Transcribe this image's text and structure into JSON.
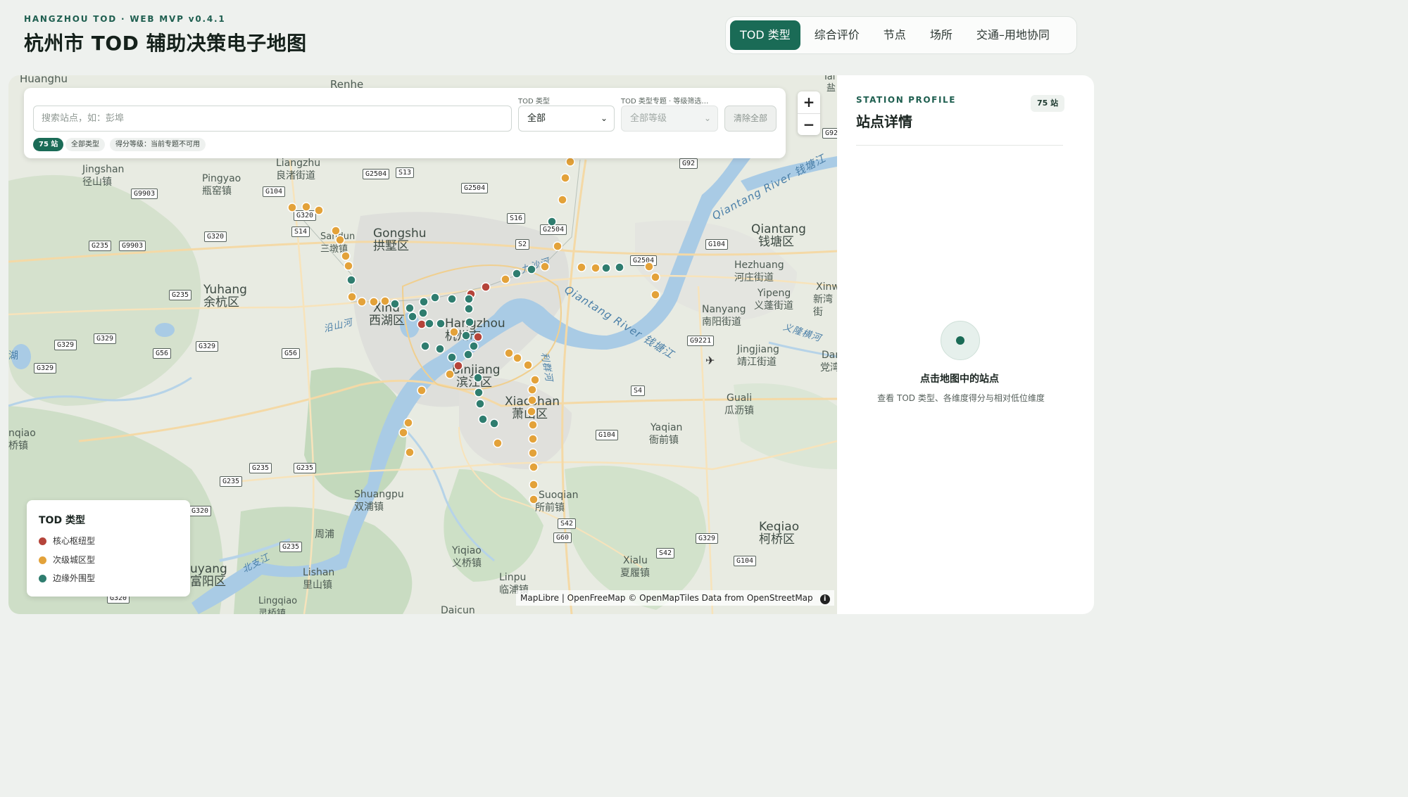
{
  "header": {
    "kicker": "HANGZHOU TOD · WEB MVP v0.4.1",
    "title": "杭州市 TOD 辅助决策电子地图"
  },
  "tabs": [
    {
      "label": "TOD 类型",
      "active": true
    },
    {
      "label": "综合评价",
      "active": false
    },
    {
      "label": "节点",
      "active": false
    },
    {
      "label": "场所",
      "active": false
    },
    {
      "label": "交通–用地协同",
      "active": false
    }
  ],
  "search": {
    "placeholder": "搜索站点，如：彭埠",
    "tod_type_label": "TOD 类型",
    "tod_type_value": "全部",
    "level_label": "TOD 类型专题 · 等级筛选…",
    "level_value": "全部等级",
    "clear_label": "清除全部"
  },
  "chips": {
    "count": "75 站",
    "type": "全部类型",
    "score": "得分等级：当前专题不可用"
  },
  "zoom": {
    "in": "+",
    "out": "−"
  },
  "legend": {
    "title": "TOD 类型",
    "items": [
      {
        "label": "核心枢纽型",
        "color": "#b5443a"
      },
      {
        "label": "次级城区型",
        "color": "#e3a23a"
      },
      {
        "label": "边缘外围型",
        "color": "#2f7d6f"
      }
    ]
  },
  "map_labels": {
    "huanghu": "Huanghu",
    "renhe": "Renhe",
    "jingshan_en": "Jingshan",
    "jingshan_zh": "径山镇",
    "liangzhu_en": "Liangzhu",
    "liangzhu_zh": "良渚街道",
    "pingyao_en": "Pingyao",
    "pingyao_zh": "瓶窑镇",
    "gongshu_en": "Gongshu",
    "gongshu_zh": "拱墅区",
    "sandun_en": "Sandun",
    "sandun_zh": "三墩镇",
    "yuhang_en": "Yuhang",
    "yuhang_zh": "余杭区",
    "xihu_en": "Xihu",
    "xihu_zh": "西湖区",
    "hangzhou_en": "Hangzhou",
    "hangzhou_zh": "杭州市",
    "binjiang_en": "Binjiang",
    "binjiang_zh": "滨江区",
    "xiaoshan_en": "Xiaoshan",
    "xiaoshan_zh": "萧山区",
    "qiantang_en": "Qiantang",
    "qiantang_zh": "钱塘区",
    "hezhuang_en": "Hezhuang",
    "hezhuang_zh": "河庄街道",
    "yipeng_en": "Yipeng",
    "yipeng_zh": "义蓬街道",
    "xinwan_en": "Xinw",
    "xinwan_zh": "新湾街",
    "nanyang_en": "Nanyang",
    "nanyang_zh": "南阳街道",
    "jingjiang_en": "Jingjiang",
    "jingjiang_zh": "靖江街道",
    "dangwan_en": "Danc",
    "dangwan_zh": "党湾",
    "guali_en": "Guali",
    "guali_zh": "瓜沥镇",
    "yaqian_en": "Yaqian",
    "yaqian_zh": "衙前镇",
    "suoqian_en": "Suoqian",
    "suoqian_zh": "所前镇",
    "shuangpu_en": "Shuangpu",
    "shuangpu_zh": "双浦镇",
    "zhoupu": "周浦",
    "yiqiao_en": "Yiqiao",
    "yiqiao_zh": "义桥镇",
    "lishan_en": "Lishan",
    "lishan_zh": "里山镇",
    "linpu_en": "Linpu",
    "linpu_zh": "临浦镇",
    "xialu_en": "Xialu",
    "xialu_zh": "夏履镇",
    "keqiao_en": "Keqiao",
    "keqiao_zh": "柯桥区",
    "fuyang_en": "uyang",
    "fuyang_zh": "富阳区",
    "lingqiao_en": "Lingqiao",
    "lingqiao_zh": "灵桥镇",
    "daicun": "Daicun",
    "qiqiao_en": "nqiao",
    "qiqiao_zh": "桥镇",
    "hu_edge": "湖",
    "yan_edge": "盐",
    "tai_edge": "Tai"
  },
  "river_labels": {
    "qiantang_river_1": "Qiantang River 钱塘江",
    "qiantang_river_2": "Qiantang River 钱塘江",
    "jiulong": "九沙河",
    "yilong": "义隆横河",
    "yanshan": "沿山河",
    "lishu": "利群河",
    "beizhi": "北支江"
  },
  "shields": [
    "G9903",
    "G2504",
    "S13",
    "G104",
    "G320",
    "S14",
    "G2504",
    "S16",
    "G2504",
    "S2",
    "G92",
    "G92",
    "G235",
    "G9903",
    "G320",
    "G235",
    "G329",
    "G329",
    "G56",
    "G329",
    "G56",
    "G329",
    "G2504",
    "G104",
    "G9221",
    "S4",
    "G104",
    "G235",
    "G235",
    "G235",
    "G320",
    "G235",
    "S42",
    "G60",
    "G329",
    "S42",
    "G104",
    "G320",
    "G329",
    "G320"
  ],
  "stations": {
    "core_hub": 5,
    "secondary_urban": 41,
    "peripheral": 29
  },
  "attribution": "MapLibre | OpenFreeMap © OpenMapTiles Data from OpenStreetMap",
  "sidebar": {
    "kicker": "STATION PROFILE",
    "title": "站点详情",
    "badge": "75 站",
    "empty_title": "点击地图中的站点",
    "empty_desc": "查看 TOD 类型、各维度得分与相对低位维度"
  }
}
